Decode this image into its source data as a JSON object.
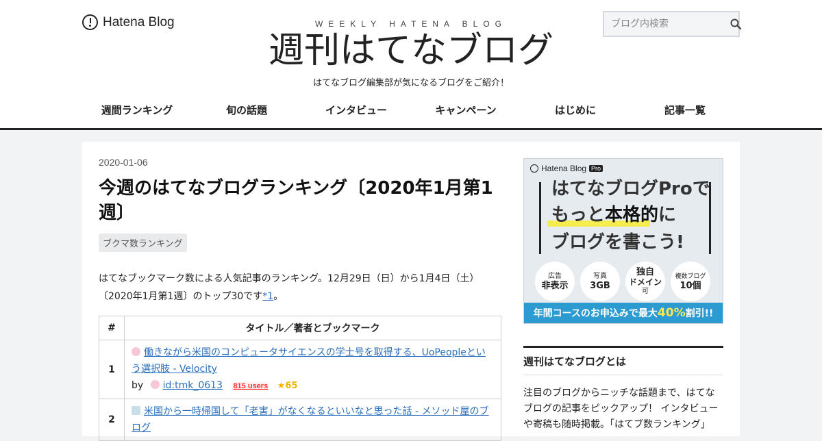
{
  "header": {
    "logo_text": "Hatena Blog",
    "subtitle_en": "WEEKLY HATENA BLOG",
    "site_title": "週刊はてなブログ",
    "tagline": "はてなブログ編集部が気になるブログをご紹介！",
    "search_placeholder": "ブログ内検索"
  },
  "nav": {
    "items": [
      "週間ランキング",
      "旬の話題",
      "インタビュー",
      "キャンペーン",
      "はじめに",
      "記事一覧"
    ]
  },
  "article": {
    "date": "2020-01-06",
    "title": "今週のはてなブログランキング〔2020年1月第1週〕",
    "tag": "ブクマ数ランキング",
    "intro": "はてなブックマーク数による人気記事のランキング。12月29日（日）から1月4日（土）〔2020年1月第1週〕のトップ30です",
    "footnote_link": "*1",
    "intro_end": "。",
    "table": {
      "col_num": "#",
      "col_title": "タイトル／著者とブックマーク",
      "rows": [
        {
          "rank": "1",
          "title": "働きながら米国のコンピュータサイエンスの学士号を取得する、UoPeopleという選択肢 - Velocity",
          "by": "by",
          "author": "id:tmk_0613",
          "users": "815 users",
          "stars": "65"
        },
        {
          "rank": "2",
          "title": "米国から一時帰国して「老害」がなくなるといいなと思った話 - メソッド屋のブログ"
        }
      ]
    }
  },
  "sidebar": {
    "banner": {
      "logo": "Hatena Blog",
      "badge": "Pro",
      "line1": "はてなブログProで",
      "line2a": "もっと",
      "line2b": "本格的",
      "line2c": "に",
      "line3": "ブログを書こう!",
      "circles": [
        {
          "small": "広告",
          "big": "非表示"
        },
        {
          "small": "写真",
          "big": "3GB"
        },
        {
          "small": "独自",
          "big": "ドメイン",
          "small2": "可"
        },
        {
          "small": "複数ブログ",
          "big": "10個"
        }
      ],
      "foot_a": "年間コースのお申込みで最大",
      "foot_pct": "40%",
      "foot_b": "割引!!"
    },
    "about_heading": "週刊はてなブログとは",
    "about_text": "注目のブログからニッチな話題まで、はてなブログの記事をピックアップ！ インタビューや寄稿も随時掲載。「はてブ数ランキング」"
  }
}
